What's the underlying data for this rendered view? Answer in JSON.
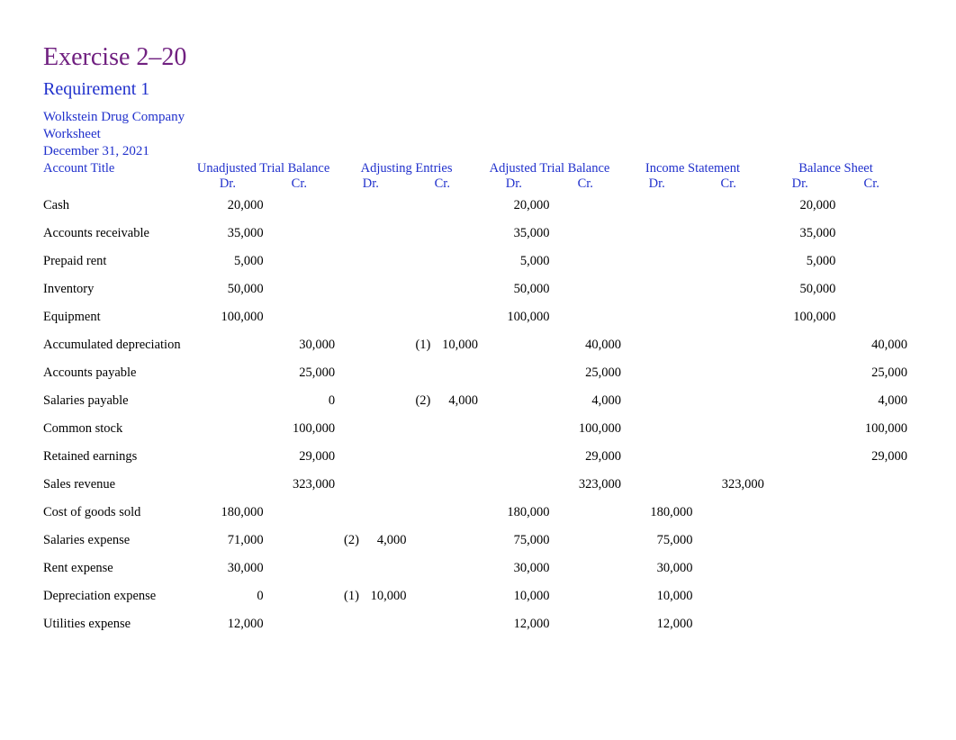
{
  "title": "Exercise 2–20",
  "subtitle": "Requirement 1",
  "company": {
    "line1": "Wolkstein Drug Company",
    "line2": "Worksheet",
    "line3": "December 31, 2021"
  },
  "headers": {
    "acct": "Account Title",
    "utb": "Unadjusted Trial Balance",
    "adj": "Adjusting Entries",
    "atb": "Adjusted Trial Balance",
    "is": "Income Statement",
    "bs": "Balance Sheet",
    "dr": "Dr.",
    "cr": "Cr."
  },
  "rows": [
    {
      "acct": "Cash",
      "utb_dr": "20,000",
      "utb_cr": "",
      "adj_dr_ref": "",
      "adj_dr_val": "",
      "adj_cr_ref": "",
      "adj_cr_val": "",
      "atb_dr": "20,000",
      "atb_cr": "",
      "is_dr": "",
      "is_cr": "",
      "bs_dr": "20,000",
      "bs_cr": ""
    },
    {
      "acct": "Accounts receivable",
      "utb_dr": "35,000",
      "utb_cr": "",
      "adj_dr_ref": "",
      "adj_dr_val": "",
      "adj_cr_ref": "",
      "adj_cr_val": "",
      "atb_dr": "35,000",
      "atb_cr": "",
      "is_dr": "",
      "is_cr": "",
      "bs_dr": "35,000",
      "bs_cr": ""
    },
    {
      "acct": "Prepaid rent",
      "utb_dr": "5,000",
      "utb_cr": "",
      "adj_dr_ref": "",
      "adj_dr_val": "",
      "adj_cr_ref": "",
      "adj_cr_val": "",
      "atb_dr": "5,000",
      "atb_cr": "",
      "is_dr": "",
      "is_cr": "",
      "bs_dr": "5,000",
      "bs_cr": ""
    },
    {
      "acct": "Inventory",
      "utb_dr": "50,000",
      "utb_cr": "",
      "adj_dr_ref": "",
      "adj_dr_val": "",
      "adj_cr_ref": "",
      "adj_cr_val": "",
      "atb_dr": "50,000",
      "atb_cr": "",
      "is_dr": "",
      "is_cr": "",
      "bs_dr": "50,000",
      "bs_cr": ""
    },
    {
      "acct": "Equipment",
      "utb_dr": "100,000",
      "utb_cr": "",
      "adj_dr_ref": "",
      "adj_dr_val": "",
      "adj_cr_ref": "",
      "adj_cr_val": "",
      "atb_dr": "100,000",
      "atb_cr": "",
      "is_dr": "",
      "is_cr": "",
      "bs_dr": "100,000",
      "bs_cr": ""
    },
    {
      "acct": "Accumulated depreciation",
      "utb_dr": "",
      "utb_cr": "30,000",
      "adj_dr_ref": "",
      "adj_dr_val": "",
      "adj_cr_ref": "(1)",
      "adj_cr_val": "10,000",
      "atb_dr": "",
      "atb_cr": "40,000",
      "is_dr": "",
      "is_cr": "",
      "bs_dr": "",
      "bs_cr": "40,000"
    },
    {
      "acct": "Accounts payable",
      "utb_dr": "",
      "utb_cr": "25,000",
      "adj_dr_ref": "",
      "adj_dr_val": "",
      "adj_cr_ref": "",
      "adj_cr_val": "",
      "atb_dr": "",
      "atb_cr": "25,000",
      "is_dr": "",
      "is_cr": "",
      "bs_dr": "",
      "bs_cr": "25,000"
    },
    {
      "acct": "Salaries payable",
      "utb_dr": "",
      "utb_cr": "0",
      "adj_dr_ref": "",
      "adj_dr_val": "",
      "adj_cr_ref": "(2)",
      "adj_cr_val": "4,000",
      "atb_dr": "",
      "atb_cr": "4,000",
      "is_dr": "",
      "is_cr": "",
      "bs_dr": "",
      "bs_cr": "4,000"
    },
    {
      "acct": "Common stock",
      "utb_dr": "",
      "utb_cr": "100,000",
      "adj_dr_ref": "",
      "adj_dr_val": "",
      "adj_cr_ref": "",
      "adj_cr_val": "",
      "atb_dr": "",
      "atb_cr": "100,000",
      "is_dr": "",
      "is_cr": "",
      "bs_dr": "",
      "bs_cr": "100,000"
    },
    {
      "acct": "Retained earnings",
      "utb_dr": "",
      "utb_cr": "29,000",
      "adj_dr_ref": "",
      "adj_dr_val": "",
      "adj_cr_ref": "",
      "adj_cr_val": "",
      "atb_dr": "",
      "atb_cr": "29,000",
      "is_dr": "",
      "is_cr": "",
      "bs_dr": "",
      "bs_cr": "29,000"
    },
    {
      "acct": "Sales revenue",
      "utb_dr": "",
      "utb_cr": "323,000",
      "adj_dr_ref": "",
      "adj_dr_val": "",
      "adj_cr_ref": "",
      "adj_cr_val": "",
      "atb_dr": "",
      "atb_cr": "323,000",
      "is_dr": "",
      "is_cr": "323,000",
      "bs_dr": "",
      "bs_cr": ""
    },
    {
      "acct": "Cost of goods sold",
      "utb_dr": "180,000",
      "utb_cr": "",
      "adj_dr_ref": "",
      "adj_dr_val": "",
      "adj_cr_ref": "",
      "adj_cr_val": "",
      "atb_dr": "180,000",
      "atb_cr": "",
      "is_dr": "180,000",
      "is_cr": "",
      "bs_dr": "",
      "bs_cr": ""
    },
    {
      "acct": "Salaries expense",
      "utb_dr": "71,000",
      "utb_cr": "",
      "adj_dr_ref": "(2)",
      "adj_dr_val": "4,000",
      "adj_cr_ref": "",
      "adj_cr_val": "",
      "atb_dr": "75,000",
      "atb_cr": "",
      "is_dr": "75,000",
      "is_cr": "",
      "bs_dr": "",
      "bs_cr": ""
    },
    {
      "acct": "Rent expense",
      "utb_dr": "30,000",
      "utb_cr": "",
      "adj_dr_ref": "",
      "adj_dr_val": "",
      "adj_cr_ref": "",
      "adj_cr_val": "",
      "atb_dr": "30,000",
      "atb_cr": "",
      "is_dr": "30,000",
      "is_cr": "",
      "bs_dr": "",
      "bs_cr": ""
    },
    {
      "acct": "Depreciation expense",
      "utb_dr": "0",
      "utb_cr": "",
      "adj_dr_ref": "(1)",
      "adj_dr_val": "10,000",
      "adj_cr_ref": "",
      "adj_cr_val": "",
      "atb_dr": "10,000",
      "atb_cr": "",
      "is_dr": "10,000",
      "is_cr": "",
      "bs_dr": "",
      "bs_cr": ""
    },
    {
      "acct": "Utilities expense",
      "utb_dr": "12,000",
      "utb_cr": "",
      "adj_dr_ref": "",
      "adj_dr_val": "",
      "adj_cr_ref": "",
      "adj_cr_val": "",
      "atb_dr": "12,000",
      "atb_cr": "",
      "is_dr": "12,000",
      "is_cr": "",
      "bs_dr": "",
      "bs_cr": ""
    }
  ]
}
